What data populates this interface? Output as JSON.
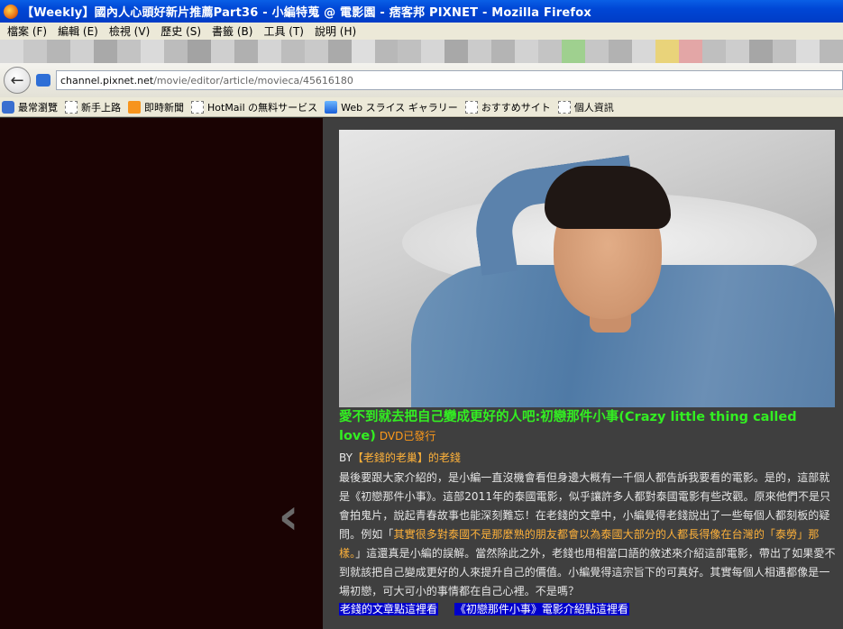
{
  "window": {
    "title": "【Weekly】國內人心頭好新片推薦Part36 - 小編特蒐 @ 電影園 - 痞客邦 PIXNET - Mozilla Firefox"
  },
  "menu": [
    "檔案 (F)",
    "編輯 (E)",
    "檢視 (V)",
    "歷史 (S)",
    "書籤 (B)",
    "工具 (T)",
    "說明 (H)"
  ],
  "nav": {
    "url_domain": "channel.pixnet.net",
    "url_path": "/movie/editor/article/movieca/45616180"
  },
  "bookmarks": [
    "最常瀏覽",
    "新手上路",
    "即時新聞",
    "HotMail の無料サービス",
    "Web スライス ギャラリー",
    "おすすめサイト",
    "個人資訊"
  ],
  "article": {
    "title": "愛不到就去把自己變成更好的人吧:初戀那件小事(Crazy little thing called love)",
    "title_sub": "DVD已發行",
    "by_prefix": "BY",
    "author": "【老錢的老巢】的老錢",
    "para_1": "最後要跟大家介紹的，是小編一直沒機會看但身邊大概有一千個人都告訴我要看的電影。是的，這部就是《初戀那件小事》。這部2011年的泰國電影，似乎讓許多人都對泰國電影有些改觀。原來他們不是只會拍鬼片，說起青春故事也能深刻難忘！在老錢的文章中，小編覺得老錢說出了一些每個人都刻板的疑問。例如「",
    "highlight": "其實很多對泰國不是那麼熟的朋友都會以為泰國大部分的人都長得像在台灣的「泰勞」那樣。",
    "para_2": "」這還真是小編的誤解。當然除此之外，老錢也用相當口語的敘述來介紹這部電影，帶出了如果愛不到就該把自己變成更好的人來提升自己的價值。小編覺得這宗旨下的可真好。其實每個人相遇都像是一場初戀，可大可小的事情都在自己心裡。不是嗎？",
    "link_1": "老錢的文章點這裡看",
    "link_2": "《初戀那件小事》電影介紹點這裡看"
  },
  "colors": {
    "title_green": "#33ee22",
    "accent_orange": "#ffb23a",
    "left_panel": "#1a0303",
    "right_panel": "#3f3f3f",
    "link_bg": "#0000cc"
  }
}
